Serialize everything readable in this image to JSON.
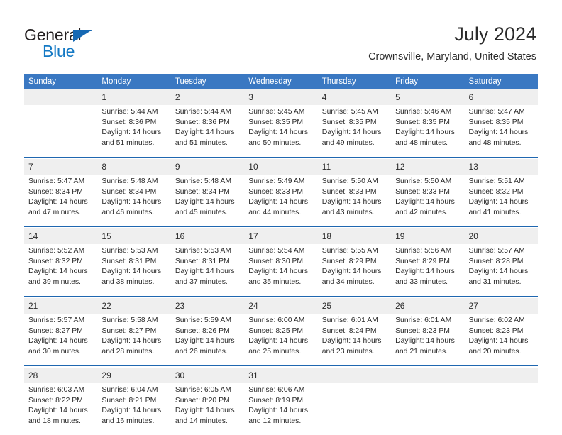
{
  "brand": {
    "name_top": "General",
    "name_bottom": "Blue",
    "triangle_icon": "blue-triangle-logo-icon",
    "accent_color": "#1479c4"
  },
  "header": {
    "title": "July 2024",
    "subtitle": "Crownsville, Maryland, United States"
  },
  "theme": {
    "header_row_bg": "#3a78c2",
    "week_separator": "#1f67b0",
    "daynum_bg": "#efefef",
    "text": "#2b2b2b"
  },
  "calendar": {
    "day_headers": [
      "Sunday",
      "Monday",
      "Tuesday",
      "Wednesday",
      "Thursday",
      "Friday",
      "Saturday"
    ],
    "weeks": [
      {
        "days": [
          {
            "num": "",
            "sunrise": "",
            "sunset": "",
            "daylight_a": "",
            "daylight_b": ""
          },
          {
            "num": "1",
            "sunrise": "Sunrise: 5:44 AM",
            "sunset": "Sunset: 8:36 PM",
            "daylight_a": "Daylight: 14 hours",
            "daylight_b": "and 51 minutes."
          },
          {
            "num": "2",
            "sunrise": "Sunrise: 5:44 AM",
            "sunset": "Sunset: 8:36 PM",
            "daylight_a": "Daylight: 14 hours",
            "daylight_b": "and 51 minutes."
          },
          {
            "num": "3",
            "sunrise": "Sunrise: 5:45 AM",
            "sunset": "Sunset: 8:35 PM",
            "daylight_a": "Daylight: 14 hours",
            "daylight_b": "and 50 minutes."
          },
          {
            "num": "4",
            "sunrise": "Sunrise: 5:45 AM",
            "sunset": "Sunset: 8:35 PM",
            "daylight_a": "Daylight: 14 hours",
            "daylight_b": "and 49 minutes."
          },
          {
            "num": "5",
            "sunrise": "Sunrise: 5:46 AM",
            "sunset": "Sunset: 8:35 PM",
            "daylight_a": "Daylight: 14 hours",
            "daylight_b": "and 48 minutes."
          },
          {
            "num": "6",
            "sunrise": "Sunrise: 5:47 AM",
            "sunset": "Sunset: 8:35 PM",
            "daylight_a": "Daylight: 14 hours",
            "daylight_b": "and 48 minutes."
          }
        ]
      },
      {
        "days": [
          {
            "num": "7",
            "sunrise": "Sunrise: 5:47 AM",
            "sunset": "Sunset: 8:34 PM",
            "daylight_a": "Daylight: 14 hours",
            "daylight_b": "and 47 minutes."
          },
          {
            "num": "8",
            "sunrise": "Sunrise: 5:48 AM",
            "sunset": "Sunset: 8:34 PM",
            "daylight_a": "Daylight: 14 hours",
            "daylight_b": "and 46 minutes."
          },
          {
            "num": "9",
            "sunrise": "Sunrise: 5:48 AM",
            "sunset": "Sunset: 8:34 PM",
            "daylight_a": "Daylight: 14 hours",
            "daylight_b": "and 45 minutes."
          },
          {
            "num": "10",
            "sunrise": "Sunrise: 5:49 AM",
            "sunset": "Sunset: 8:33 PM",
            "daylight_a": "Daylight: 14 hours",
            "daylight_b": "and 44 minutes."
          },
          {
            "num": "11",
            "sunrise": "Sunrise: 5:50 AM",
            "sunset": "Sunset: 8:33 PM",
            "daylight_a": "Daylight: 14 hours",
            "daylight_b": "and 43 minutes."
          },
          {
            "num": "12",
            "sunrise": "Sunrise: 5:50 AM",
            "sunset": "Sunset: 8:33 PM",
            "daylight_a": "Daylight: 14 hours",
            "daylight_b": "and 42 minutes."
          },
          {
            "num": "13",
            "sunrise": "Sunrise: 5:51 AM",
            "sunset": "Sunset: 8:32 PM",
            "daylight_a": "Daylight: 14 hours",
            "daylight_b": "and 41 minutes."
          }
        ]
      },
      {
        "days": [
          {
            "num": "14",
            "sunrise": "Sunrise: 5:52 AM",
            "sunset": "Sunset: 8:32 PM",
            "daylight_a": "Daylight: 14 hours",
            "daylight_b": "and 39 minutes."
          },
          {
            "num": "15",
            "sunrise": "Sunrise: 5:53 AM",
            "sunset": "Sunset: 8:31 PM",
            "daylight_a": "Daylight: 14 hours",
            "daylight_b": "and 38 minutes."
          },
          {
            "num": "16",
            "sunrise": "Sunrise: 5:53 AM",
            "sunset": "Sunset: 8:31 PM",
            "daylight_a": "Daylight: 14 hours",
            "daylight_b": "and 37 minutes."
          },
          {
            "num": "17",
            "sunrise": "Sunrise: 5:54 AM",
            "sunset": "Sunset: 8:30 PM",
            "daylight_a": "Daylight: 14 hours",
            "daylight_b": "and 35 minutes."
          },
          {
            "num": "18",
            "sunrise": "Sunrise: 5:55 AM",
            "sunset": "Sunset: 8:29 PM",
            "daylight_a": "Daylight: 14 hours",
            "daylight_b": "and 34 minutes."
          },
          {
            "num": "19",
            "sunrise": "Sunrise: 5:56 AM",
            "sunset": "Sunset: 8:29 PM",
            "daylight_a": "Daylight: 14 hours",
            "daylight_b": "and 33 minutes."
          },
          {
            "num": "20",
            "sunrise": "Sunrise: 5:57 AM",
            "sunset": "Sunset: 8:28 PM",
            "daylight_a": "Daylight: 14 hours",
            "daylight_b": "and 31 minutes."
          }
        ]
      },
      {
        "days": [
          {
            "num": "21",
            "sunrise": "Sunrise: 5:57 AM",
            "sunset": "Sunset: 8:27 PM",
            "daylight_a": "Daylight: 14 hours",
            "daylight_b": "and 30 minutes."
          },
          {
            "num": "22",
            "sunrise": "Sunrise: 5:58 AM",
            "sunset": "Sunset: 8:27 PM",
            "daylight_a": "Daylight: 14 hours",
            "daylight_b": "and 28 minutes."
          },
          {
            "num": "23",
            "sunrise": "Sunrise: 5:59 AM",
            "sunset": "Sunset: 8:26 PM",
            "daylight_a": "Daylight: 14 hours",
            "daylight_b": "and 26 minutes."
          },
          {
            "num": "24",
            "sunrise": "Sunrise: 6:00 AM",
            "sunset": "Sunset: 8:25 PM",
            "daylight_a": "Daylight: 14 hours",
            "daylight_b": "and 25 minutes."
          },
          {
            "num": "25",
            "sunrise": "Sunrise: 6:01 AM",
            "sunset": "Sunset: 8:24 PM",
            "daylight_a": "Daylight: 14 hours",
            "daylight_b": "and 23 minutes."
          },
          {
            "num": "26",
            "sunrise": "Sunrise: 6:01 AM",
            "sunset": "Sunset: 8:23 PM",
            "daylight_a": "Daylight: 14 hours",
            "daylight_b": "and 21 minutes."
          },
          {
            "num": "27",
            "sunrise": "Sunrise: 6:02 AM",
            "sunset": "Sunset: 8:23 PM",
            "daylight_a": "Daylight: 14 hours",
            "daylight_b": "and 20 minutes."
          }
        ]
      },
      {
        "days": [
          {
            "num": "28",
            "sunrise": "Sunrise: 6:03 AM",
            "sunset": "Sunset: 8:22 PM",
            "daylight_a": "Daylight: 14 hours",
            "daylight_b": "and 18 minutes."
          },
          {
            "num": "29",
            "sunrise": "Sunrise: 6:04 AM",
            "sunset": "Sunset: 8:21 PM",
            "daylight_a": "Daylight: 14 hours",
            "daylight_b": "and 16 minutes."
          },
          {
            "num": "30",
            "sunrise": "Sunrise: 6:05 AM",
            "sunset": "Sunset: 8:20 PM",
            "daylight_a": "Daylight: 14 hours",
            "daylight_b": "and 14 minutes."
          },
          {
            "num": "31",
            "sunrise": "Sunrise: 6:06 AM",
            "sunset": "Sunset: 8:19 PM",
            "daylight_a": "Daylight: 14 hours",
            "daylight_b": "and 12 minutes."
          },
          {
            "num": "",
            "sunrise": "",
            "sunset": "",
            "daylight_a": "",
            "daylight_b": ""
          },
          {
            "num": "",
            "sunrise": "",
            "sunset": "",
            "daylight_a": "",
            "daylight_b": ""
          },
          {
            "num": "",
            "sunrise": "",
            "sunset": "",
            "daylight_a": "",
            "daylight_b": ""
          }
        ]
      }
    ]
  }
}
